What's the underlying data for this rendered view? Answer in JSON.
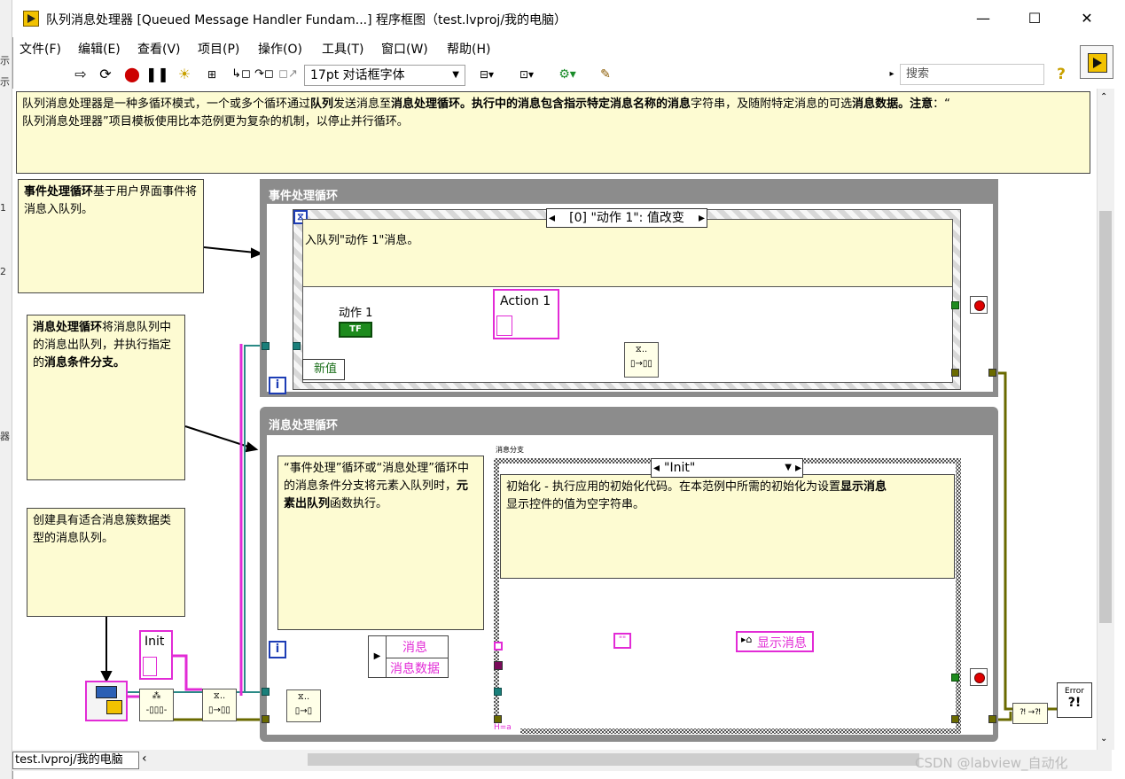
{
  "window": {
    "title": "队列消息处理器 [Queued Message Handler Fundam...] 程序框图（test.lvproj/我的电脑）",
    "minimize": "—",
    "maximize": "☐",
    "close": "✕"
  },
  "menu": [
    "文件(F)",
    "编辑(E)",
    "查看(V)",
    "项目(P)",
    "操作(O)",
    "工具(T)",
    "窗口(W)",
    "帮助(H)"
  ],
  "toolbar": {
    "font": "17pt 对话框字体",
    "search_placeholder": "搜索",
    "icons": [
      "run-arrow",
      "run-continuously",
      "abort",
      "pause",
      "highlight-execution",
      "retain-wire-values",
      "step-into",
      "step-over",
      "step-out",
      "align-objects",
      "distribute-objects",
      "reorder",
      "clean-up-diagram"
    ]
  },
  "notes": {
    "top_plain1": "队列消息处理器是一种多循环模式，一个或多个循环通过",
    "top_bold1": "队列",
    "top_plain2": "发送消息至",
    "top_bold2": "消息处理循环。执行中的消息包含指示特定消息名称的消息",
    "top_plain3": "字符串，及随附特定消息的可选",
    "top_bold3": "消息数据。注意",
    "top_plain4": "：“",
    "top_line2": "队列消息处理器”项目模板使用比本范例更为复杂的机制，以停止并行循环。",
    "event_bold": "事件处理循环",
    "event_plain": "基于用户界面事件将消息入队列。",
    "msg_bold1": "消息处理循环",
    "msg_plain1": "将消息队列中的消息出队列，并执行指定的",
    "msg_bold2": "消息条件分支。",
    "create": "创建具有适合消息簇数据类型的消息队列。",
    "enqueue_plain1": "“事件处理”循环或“消息处理”循环中的消息条件分支将元素入队列时，",
    "enqueue_bold": "元素出队列",
    "enqueue_plain2": "函数执行。",
    "init_plain1": "初始化 - 执行应用的初始化代码。在本范例中所需的初始化为设置",
    "init_bold": "显示消息",
    "init_plain2": "显示控件的值为空字符串。"
  },
  "loops": {
    "event_title": "事件处理循环",
    "message_title": "消息处理循环"
  },
  "event_structure": {
    "selector": "[0] \"动作 1\": 值改变",
    "comment": "入队列\"动作 1\"消息。",
    "control_label": "动作 1",
    "bool_text": "TF",
    "new_value": "新值",
    "action_const": "Action 1",
    "loop_i": "i"
  },
  "case_structure": {
    "label": "消息分支",
    "selector": "\"Init\"",
    "bundle_msg": "消息",
    "bundle_data": "消息数据",
    "indicator": "显示消息",
    "empty_string": "\"\"",
    "loop_i": "i"
  },
  "constants": {
    "init": "Init",
    "error_label": "Error"
  },
  "status": {
    "project": "test.lvproj/我的电脑",
    "watermark": "CSDN @labview_自动化"
  }
}
